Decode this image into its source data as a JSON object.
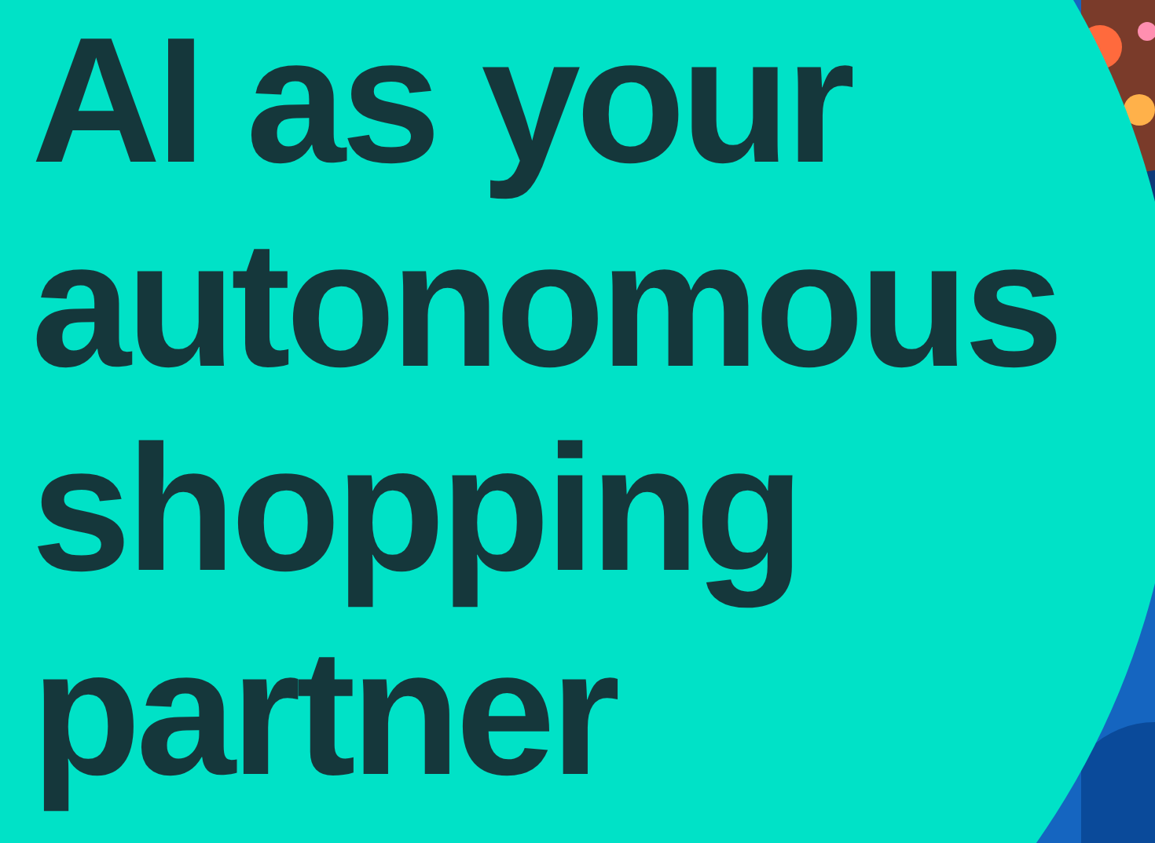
{
  "headline": {
    "lines": [
      "AI as your",
      "autonomous",
      "shopping",
      "partner"
    ]
  }
}
